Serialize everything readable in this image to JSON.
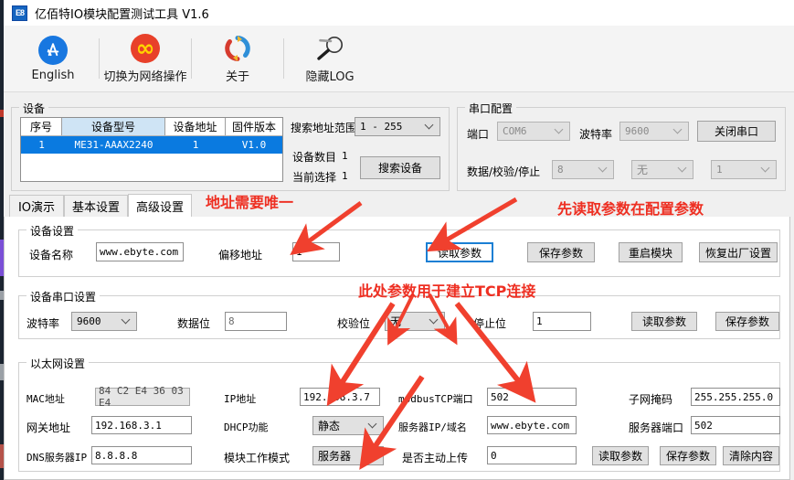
{
  "window": {
    "title": "亿佰特IO模块配置测试工具 V1.6",
    "app_icon_text": "E8"
  },
  "toolbar": {
    "items": [
      {
        "label": "English",
        "icon": "app-store-icon"
      },
      {
        "label": "切换为网络操作",
        "icon": "infinity-icon"
      },
      {
        "label": "关于",
        "icon": "refresh-circle-icon"
      },
      {
        "label": "隐藏LOG",
        "icon": "magnifier-icon"
      }
    ]
  },
  "device_group": {
    "legend": "设备",
    "table": {
      "headers": [
        "序号",
        "设备型号",
        "设备地址",
        "固件版本"
      ],
      "rows": [
        [
          "1",
          "ME31-AAAX2240",
          "1",
          "V1.0"
        ]
      ]
    },
    "search_range_label": "搜索地址范围",
    "search_range_value": "1  -  255",
    "device_count_label": "设备数目",
    "device_count_value": "1",
    "current_select_label": "当前选择",
    "current_select_value": "1",
    "search_button": "搜索设备"
  },
  "serial_group": {
    "legend": "串口配置",
    "port_label": "端口",
    "port_value": "COM6",
    "baud_label": "波特率",
    "baud_value": "9600",
    "close_button": "关闭串口",
    "dps_label": "数据/校验/停止",
    "data_value": "8",
    "parity_value": "无",
    "stop_value": "1"
  },
  "tabs": [
    {
      "label": "IO演示",
      "active": false
    },
    {
      "label": "基本设置",
      "active": false
    },
    {
      "label": "高级设置",
      "active": true
    }
  ],
  "device_settings": {
    "legend": "设备设置",
    "name_label": "设备名称",
    "name_value": "www.ebyte.com",
    "offset_label": "偏移地址",
    "offset_value": "1",
    "read_button": "读取参数",
    "save_button": "保存参数",
    "restart_button": "重启模块",
    "factory_button": "恢复出厂设置"
  },
  "device_serial_settings": {
    "legend": "设备串口设置",
    "baud_label": "波特率",
    "baud_value": "9600",
    "data_label": "数据位",
    "data_value": "8",
    "parity_label": "校验位",
    "parity_value": "无",
    "stop_label": "停止位",
    "stop_value": "1",
    "read_button": "读取参数",
    "save_button": "保存参数"
  },
  "ethernet_settings": {
    "legend": "以太网设置",
    "mac_label": "MAC地址",
    "mac_value": "84 C2 E4 36 03 E4",
    "gateway_label": "网关地址",
    "gateway_value": "192.168.3.1",
    "dns_label": "DNS服务器IP",
    "dns_value": "8.8.8.8",
    "ip_label": "IP地址",
    "ip_value": "192.168.3.7",
    "dhcp_label": "DHCP功能",
    "dhcp_value": "静态",
    "work_mode_label": "模块工作模式",
    "work_mode_value": "服务器",
    "modbus_port_label": "modbusTCP端口",
    "modbus_port_value": "502",
    "server_ip_label": "服务器IP/域名",
    "server_ip_value": "www.ebyte.com",
    "active_upload_label": "是否主动上传",
    "active_upload_value": "0",
    "subnet_label": "子网掩码",
    "subnet_value": "255.255.255.0",
    "server_port_label": "服务器端口",
    "server_port_value": "502",
    "read_button": "读取参数",
    "save_button": "保存参数",
    "clear_button": "清除内容"
  },
  "annotations": [
    {
      "text": "地址需要唯一",
      "color": "#ee2f22"
    },
    {
      "text": "先读取参数在配置参数",
      "color": "#ee2f22"
    },
    {
      "text": "此处参数用于建立TCP连接",
      "color": "#ee2f22"
    }
  ],
  "colors": {
    "accent_blue": "#0a7ae0",
    "annotation_red": "#ee2f22",
    "focus_blue": "#1a7fd4",
    "toolbar_bg": "#f4f4f4"
  }
}
